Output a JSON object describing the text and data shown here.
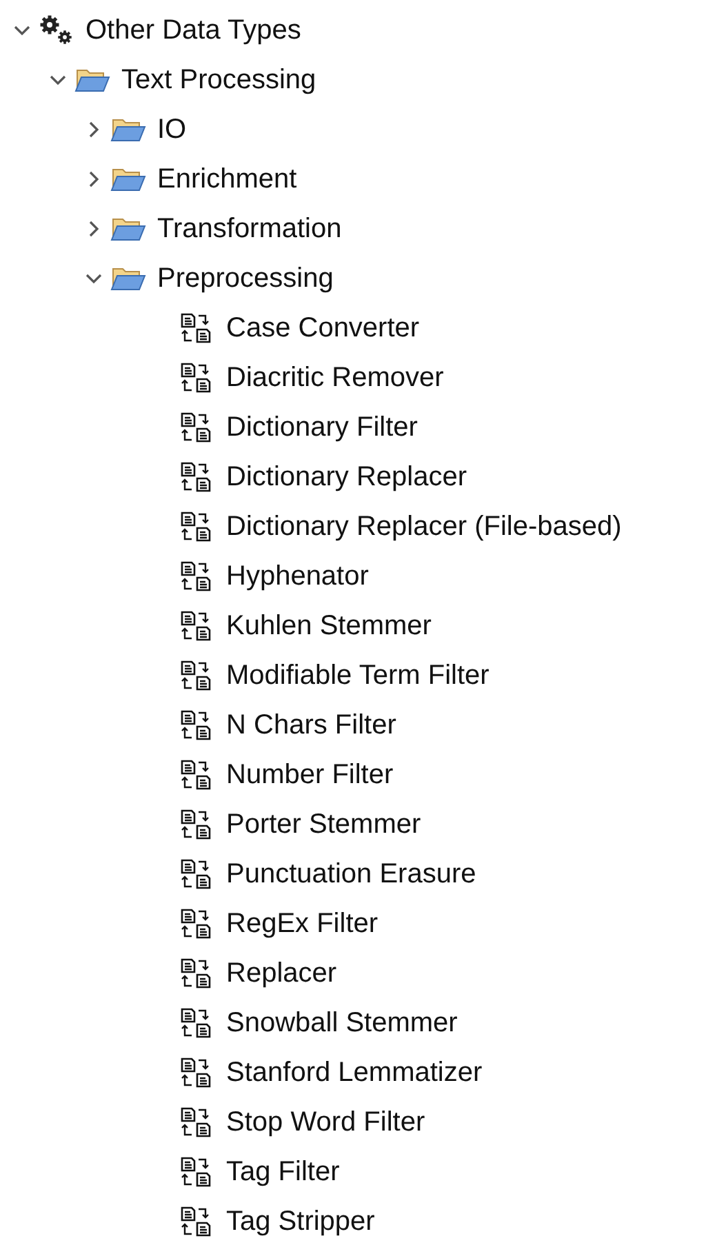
{
  "tree": [
    {
      "kind": "category",
      "label": "Other Data Types",
      "expanded": true,
      "children": [
        {
          "kind": "folder",
          "label": "Text Processing",
          "expanded": true,
          "children": [
            {
              "kind": "folder",
              "label": "IO",
              "expanded": false
            },
            {
              "kind": "folder",
              "label": "Enrichment",
              "expanded": false
            },
            {
              "kind": "folder",
              "label": "Transformation",
              "expanded": false
            },
            {
              "kind": "folder",
              "label": "Preprocessing",
              "expanded": true,
              "children": [
                {
                  "kind": "node",
                  "label": "Case Converter"
                },
                {
                  "kind": "node",
                  "label": "Diacritic Remover"
                },
                {
                  "kind": "node",
                  "label": "Dictionary Filter"
                },
                {
                  "kind": "node",
                  "label": "Dictionary Replacer"
                },
                {
                  "kind": "node",
                  "label": "Dictionary Replacer (File-based)"
                },
                {
                  "kind": "node",
                  "label": "Hyphenator"
                },
                {
                  "kind": "node",
                  "label": "Kuhlen Stemmer"
                },
                {
                  "kind": "node",
                  "label": "Modifiable Term Filter"
                },
                {
                  "kind": "node",
                  "label": "N Chars Filter"
                },
                {
                  "kind": "node",
                  "label": "Number Filter"
                },
                {
                  "kind": "node",
                  "label": "Porter Stemmer"
                },
                {
                  "kind": "node",
                  "label": "Punctuation Erasure"
                },
                {
                  "kind": "node",
                  "label": "RegEx Filter"
                },
                {
                  "kind": "node",
                  "label": "Replacer"
                },
                {
                  "kind": "node",
                  "label": "Snowball Stemmer"
                },
                {
                  "kind": "node",
                  "label": "Stanford Lemmatizer"
                },
                {
                  "kind": "node",
                  "label": "Stop Word Filter"
                },
                {
                  "kind": "node",
                  "label": "Tag Filter"
                },
                {
                  "kind": "node",
                  "label": "Tag Stripper"
                }
              ]
            }
          ]
        }
      ]
    }
  ]
}
